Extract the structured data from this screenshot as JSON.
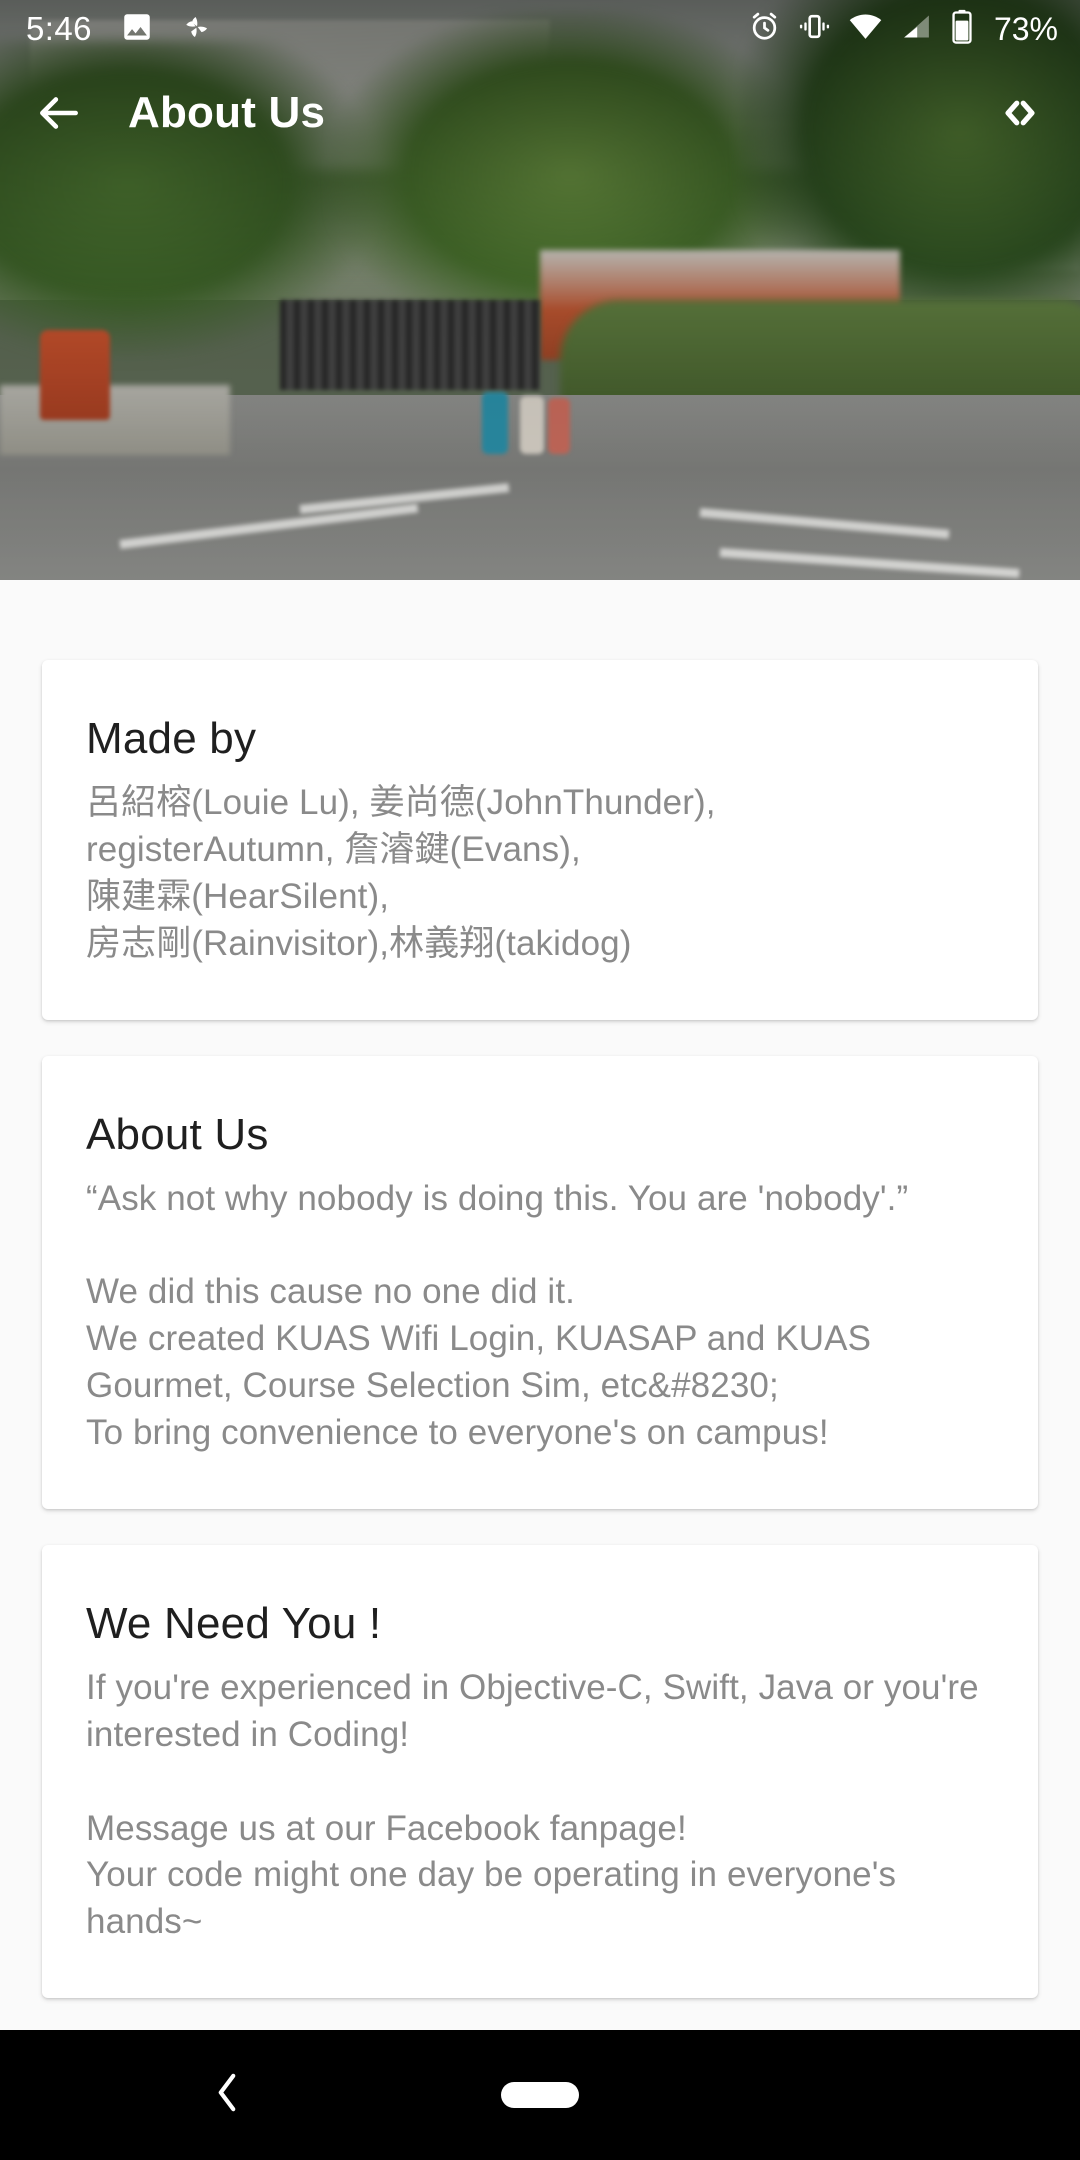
{
  "statusbar": {
    "time": "5:46",
    "battery_text": "73%",
    "icons": [
      "image-icon",
      "pinwheel-icon",
      "alarm-icon",
      "vibrate-icon",
      "wifi-icon",
      "signal-icon",
      "battery-icon"
    ]
  },
  "appbar": {
    "title": "About Us",
    "back_icon": "arrow-left-icon",
    "action_icon": "code-brackets-icon"
  },
  "cards": [
    {
      "title": "Made by",
      "body": "呂紹榕(Louie Lu), 姜尚德(JohnThunder),\nregisterAutumn, 詹濬鍵(Evans),\n陳建霖(HearSilent),\n房志剛(Rainvisitor),林義翔(takidog)"
    },
    {
      "title": "About Us",
      "body": "“Ask not why nobody is doing this. You are 'nobody'.”\n\nWe did this cause no one did it.\nWe created KUAS Wifi Login, KUASAP and KUAS Gourmet, Course Selection Sim, etc&#8230;\nTo bring convenience to everyone's on campus!"
    },
    {
      "title": "We Need You !",
      "body": "If you're experienced in Objective-C, Swift, Java or you're interested in Coding!\n\nMessage us at our Facebook fanpage!\nYour code might one day be operating in everyone's hands~"
    }
  ],
  "navbar": {
    "back_icon": "nav-back-icon",
    "home_pill": "home-pill"
  },
  "colors": {
    "page_background": "#fafafa",
    "card_background": "#ffffff",
    "title_text": "#1f1f1f",
    "body_text": "#8a8a8a",
    "navbar": "#000000",
    "statusbar_text": "#ffffff"
  }
}
